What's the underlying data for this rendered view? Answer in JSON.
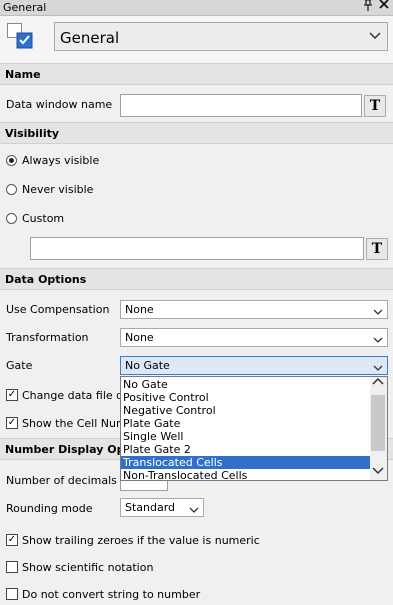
{
  "titlebar": {
    "title": "General",
    "pin_glyph": "ᴨ",
    "close_glyph": "✕"
  },
  "header": {
    "icon": "general-window-checkbox-icon",
    "combo_value": "General",
    "chevron": "⌄"
  },
  "sections": {
    "name": "Name",
    "visibility": "Visibility",
    "data_options": "Data Options",
    "number_display": "Number Display Optio"
  },
  "name_section": {
    "label": "Data window name",
    "value": "",
    "t_button": "T"
  },
  "visibility": {
    "options": [
      "Always visible",
      "Never visible",
      "Custom"
    ],
    "selected": "Always visible",
    "custom_value": "",
    "t_button": "T"
  },
  "data_options": {
    "use_compensation_label": "Use Compensation",
    "use_compensation_value": "None",
    "transformation_label": "Transformation",
    "transformation_value": "None",
    "gate_label": "Gate",
    "gate_value": "No Gate",
    "change_data_file_label": "Change data file du",
    "show_cell_num_label": "Show the Cell Num",
    "gate_options": [
      "No Gate",
      "Positive Control",
      "Negative Control",
      "Plate Gate",
      "Single Well",
      "Plate Gate 2",
      "Translocated Cells",
      "Non-Translocated Cells"
    ],
    "highlighted_option": "Translocated Cells"
  },
  "number_display": {
    "decimals_label": "Number of decimals",
    "rounding_label": "Rounding mode",
    "rounding_value": "Standard",
    "show_trailing_label": "Show trailing zeroes if the value is numeric",
    "show_scientific_label": "Show scientific notation",
    "no_convert_label": "Do not convert string to number"
  },
  "colors": {
    "selection": "#3170c8",
    "gate_combo_bg": "#dbe8f6",
    "section_bg": "#e4e4e4"
  }
}
